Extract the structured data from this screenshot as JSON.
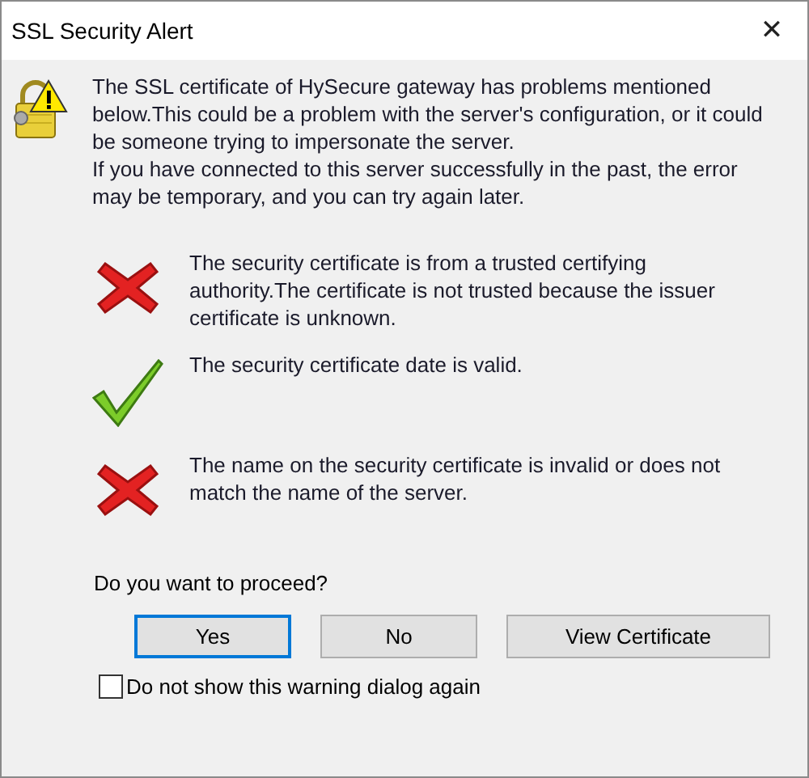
{
  "window": {
    "title": "SSL Security Alert",
    "close": "✕"
  },
  "message": [
    "The SSL certificate of HySecure gateway has problems mentioned below.This could be a problem with the server's configuration, or it could be someone trying to impersonate the server.",
    "If you have connected to this server successfully in the past, the error may be temporary, and you can try again later."
  ],
  "checks": [
    {
      "kind": "fail",
      "text": "The security certificate is from a trusted certifying authority.The certificate is not trusted because the issuer certificate is unknown."
    },
    {
      "kind": "pass",
      "text": "The security certificate date is valid."
    },
    {
      "kind": "fail",
      "text": "The name on the security certificate is invalid or does not match the name of the server."
    }
  ],
  "question": "Do you want to proceed?",
  "buttons": [
    {
      "label": "Yes",
      "default": true
    },
    {
      "label": "No",
      "default": false
    },
    {
      "label": "View Certificate",
      "default": false
    }
  ],
  "checkbox": {
    "label": "Do not show this warning dialog again",
    "checked": false
  }
}
